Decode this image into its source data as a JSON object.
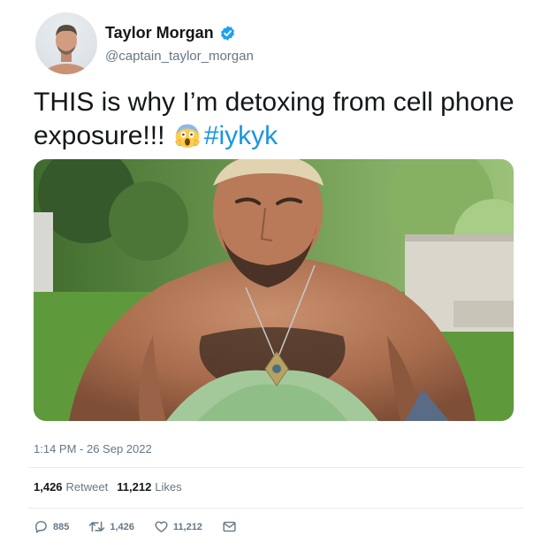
{
  "author": {
    "display_name": "Taylor Morgan",
    "handle": "@captain_taylor_morgan",
    "verified": true,
    "avatar_icon": "profile-avatar"
  },
  "tweet": {
    "text": "THIS is why I’m detoxing from cell phone exposure!!!",
    "emoji_icon": "face-screaming-in-fear-emoji",
    "hashtag": "#iykyk",
    "media_icon": "shirtless-man-pendant-photo",
    "timestamp": "1:14 PM - 26 Sep 2022"
  },
  "stats": {
    "retweets_count": "1,426",
    "retweets_label": "Retweet",
    "likes_count": "11,212",
    "likes_label": "Likes"
  },
  "actions": {
    "reply_count": "885",
    "retweet_count": "1,426",
    "like_count": "11,212",
    "reply_icon": "reply-icon",
    "retweet_icon": "retweet-icon",
    "like_icon": "heart-icon",
    "dm_icon": "envelope-icon"
  },
  "colors": {
    "link_blue": "#1b95e0",
    "verified_blue": "#1da1f2",
    "secondary_text": "#657786"
  }
}
